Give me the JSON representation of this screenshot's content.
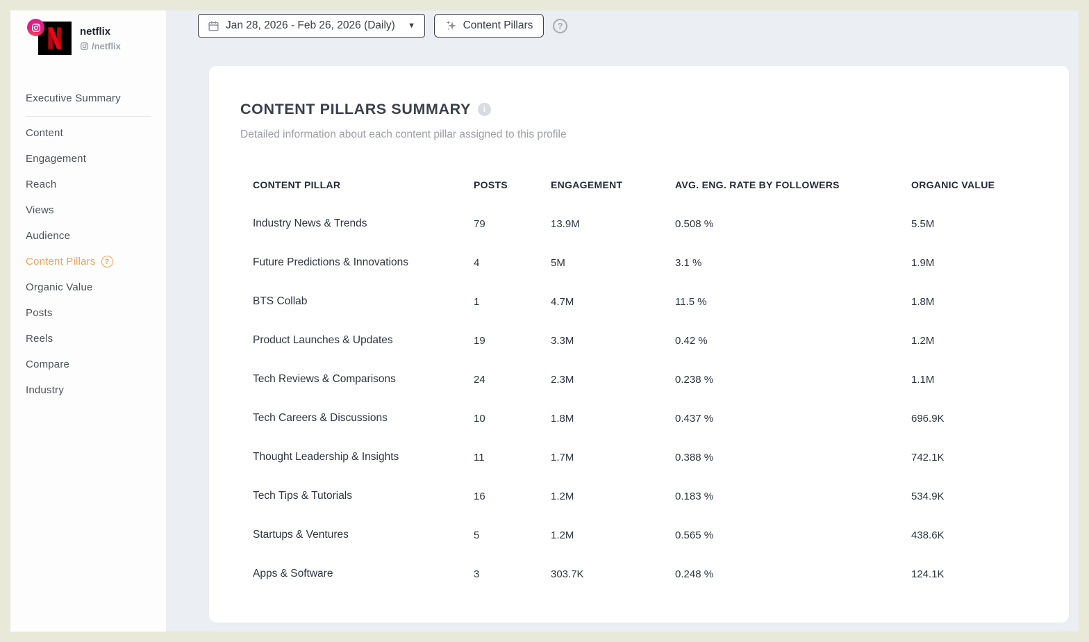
{
  "profile": {
    "name": "netflix",
    "handle": "/netflix",
    "network": "instagram"
  },
  "topbar": {
    "date_range_label": "Jan 28, 2026 - Feb 26, 2026 (Daily)",
    "content_pillars_label": "Content Pillars"
  },
  "sidebar": {
    "items": [
      {
        "label": "Executive Summary"
      },
      {
        "label": "Content"
      },
      {
        "label": "Engagement"
      },
      {
        "label": "Reach"
      },
      {
        "label": "Views"
      },
      {
        "label": "Audience"
      },
      {
        "label": "Content Pillars"
      },
      {
        "label": "Organic Value"
      },
      {
        "label": "Posts"
      },
      {
        "label": "Reels"
      },
      {
        "label": "Compare"
      },
      {
        "label": "Industry"
      }
    ],
    "active_item": "Content Pillars"
  },
  "summary": {
    "title": "CONTENT PILLARS SUMMARY",
    "subtitle": "Detailed information about each content pillar assigned to this profile"
  },
  "table": {
    "headers": [
      "CONTENT PILLAR",
      "POSTS",
      "ENGAGEMENT",
      "AVG. ENG. RATE BY FOLLOWERS",
      "ORGANIC VALUE"
    ],
    "rows": [
      [
        "Industry News & Trends",
        "79",
        "13.9M",
        "0.508 %",
        "5.5M"
      ],
      [
        "Future Predictions & Innovations",
        "4",
        "5M",
        "3.1 %",
        "1.9M"
      ],
      [
        "BTS Collab",
        "1",
        "4.7M",
        "11.5 %",
        "1.8M"
      ],
      [
        "Product Launches & Updates",
        "19",
        "3.3M",
        "0.42 %",
        "1.2M"
      ],
      [
        "Tech Reviews & Comparisons",
        "24",
        "2.3M",
        "0.238 %",
        "1.1M"
      ],
      [
        "Tech Careers & Discussions",
        "10",
        "1.8M",
        "0.437 %",
        "696.9K"
      ],
      [
        "Thought Leadership & Insights",
        "11",
        "1.7M",
        "0.388 %",
        "742.1K"
      ],
      [
        "Tech Tips & Tutorials",
        "16",
        "1.2M",
        "0.183 %",
        "534.9K"
      ],
      [
        "Startups & Ventures",
        "5",
        "1.2M",
        "0.565 %",
        "438.6K"
      ],
      [
        "Apps & Software",
        "3",
        "303.7K",
        "0.248 %",
        "124.1K"
      ]
    ]
  },
  "glyphs": {
    "caret_down": "▼",
    "question_mark": "?",
    "info": "i"
  },
  "colors": {
    "outer_background": "#e8e9d8",
    "main_background": "#ebeef2",
    "accent_orange": "#f0a35e",
    "netflix_red": "#e50914",
    "instagram_pink": "#e6197f",
    "dark_text": "#2e3442",
    "muted_text": "#9b9ea6"
  }
}
